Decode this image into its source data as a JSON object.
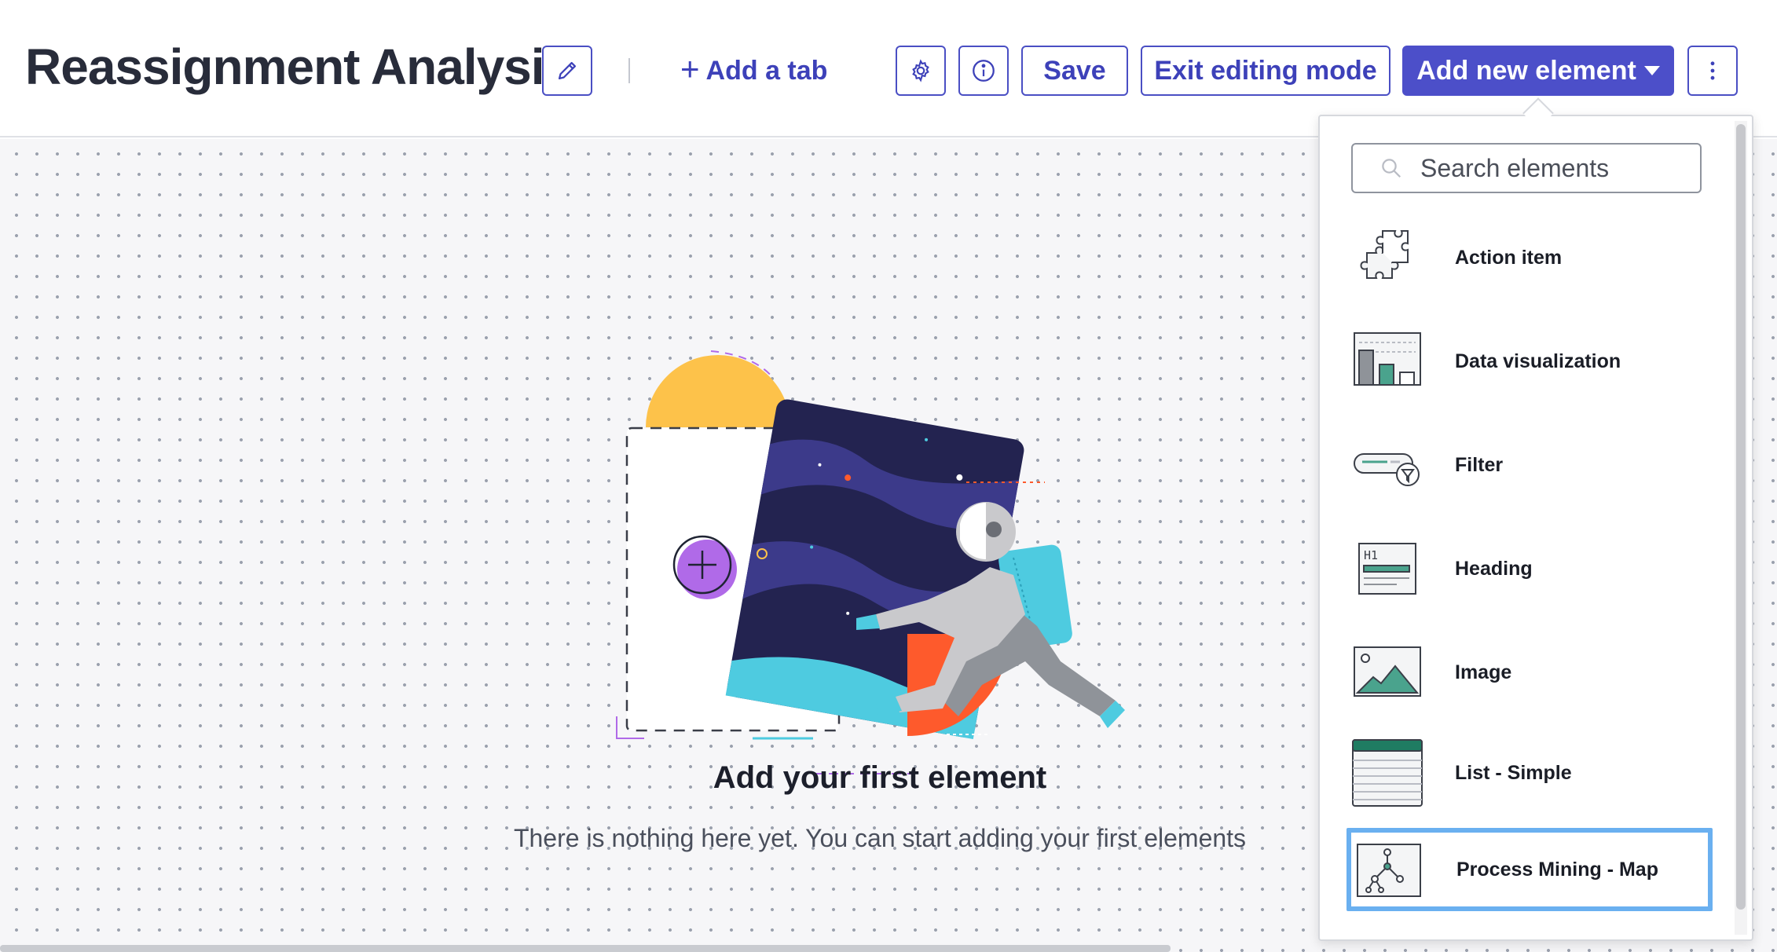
{
  "header": {
    "title": "Reassignment Analysis",
    "add_tab_label": "Add a tab",
    "save_label": "Save",
    "exit_label": "Exit editing mode",
    "add_element_label": "Add new element",
    "icons": {
      "edit": "pencil-icon",
      "settings": "gear-icon",
      "info": "info-icon",
      "more": "vertical-ellipsis-icon"
    }
  },
  "colors": {
    "primary": "#4c4fc9",
    "primary_text": "#3d41b9",
    "canvas_bg": "#f6f6f8",
    "selection": "#6ab0f0",
    "illustration_yellow": "#fdc24a",
    "illustration_navy": "#232350",
    "illustration_cyan": "#4ecbe0",
    "illustration_orange": "#fe5a2c",
    "illustration_purple": "#b06ae8"
  },
  "empty_state": {
    "title": "Add your first element",
    "subtitle": "There is nothing here yet. You can start adding your first elements"
  },
  "dropdown": {
    "search_placeholder": "Search elements",
    "items": [
      {
        "label": "Action item",
        "icon": "puzzle-piece-icon"
      },
      {
        "label": "Data visualization",
        "icon": "bar-chart-icon"
      },
      {
        "label": "Filter",
        "icon": "filter-icon"
      },
      {
        "label": "Heading",
        "icon": "heading-icon"
      },
      {
        "label": "Image",
        "icon": "image-icon"
      },
      {
        "label": "List - Simple",
        "icon": "list-icon"
      },
      {
        "label": "Process Mining - Map",
        "icon": "process-map-icon",
        "selected": true
      }
    ]
  }
}
